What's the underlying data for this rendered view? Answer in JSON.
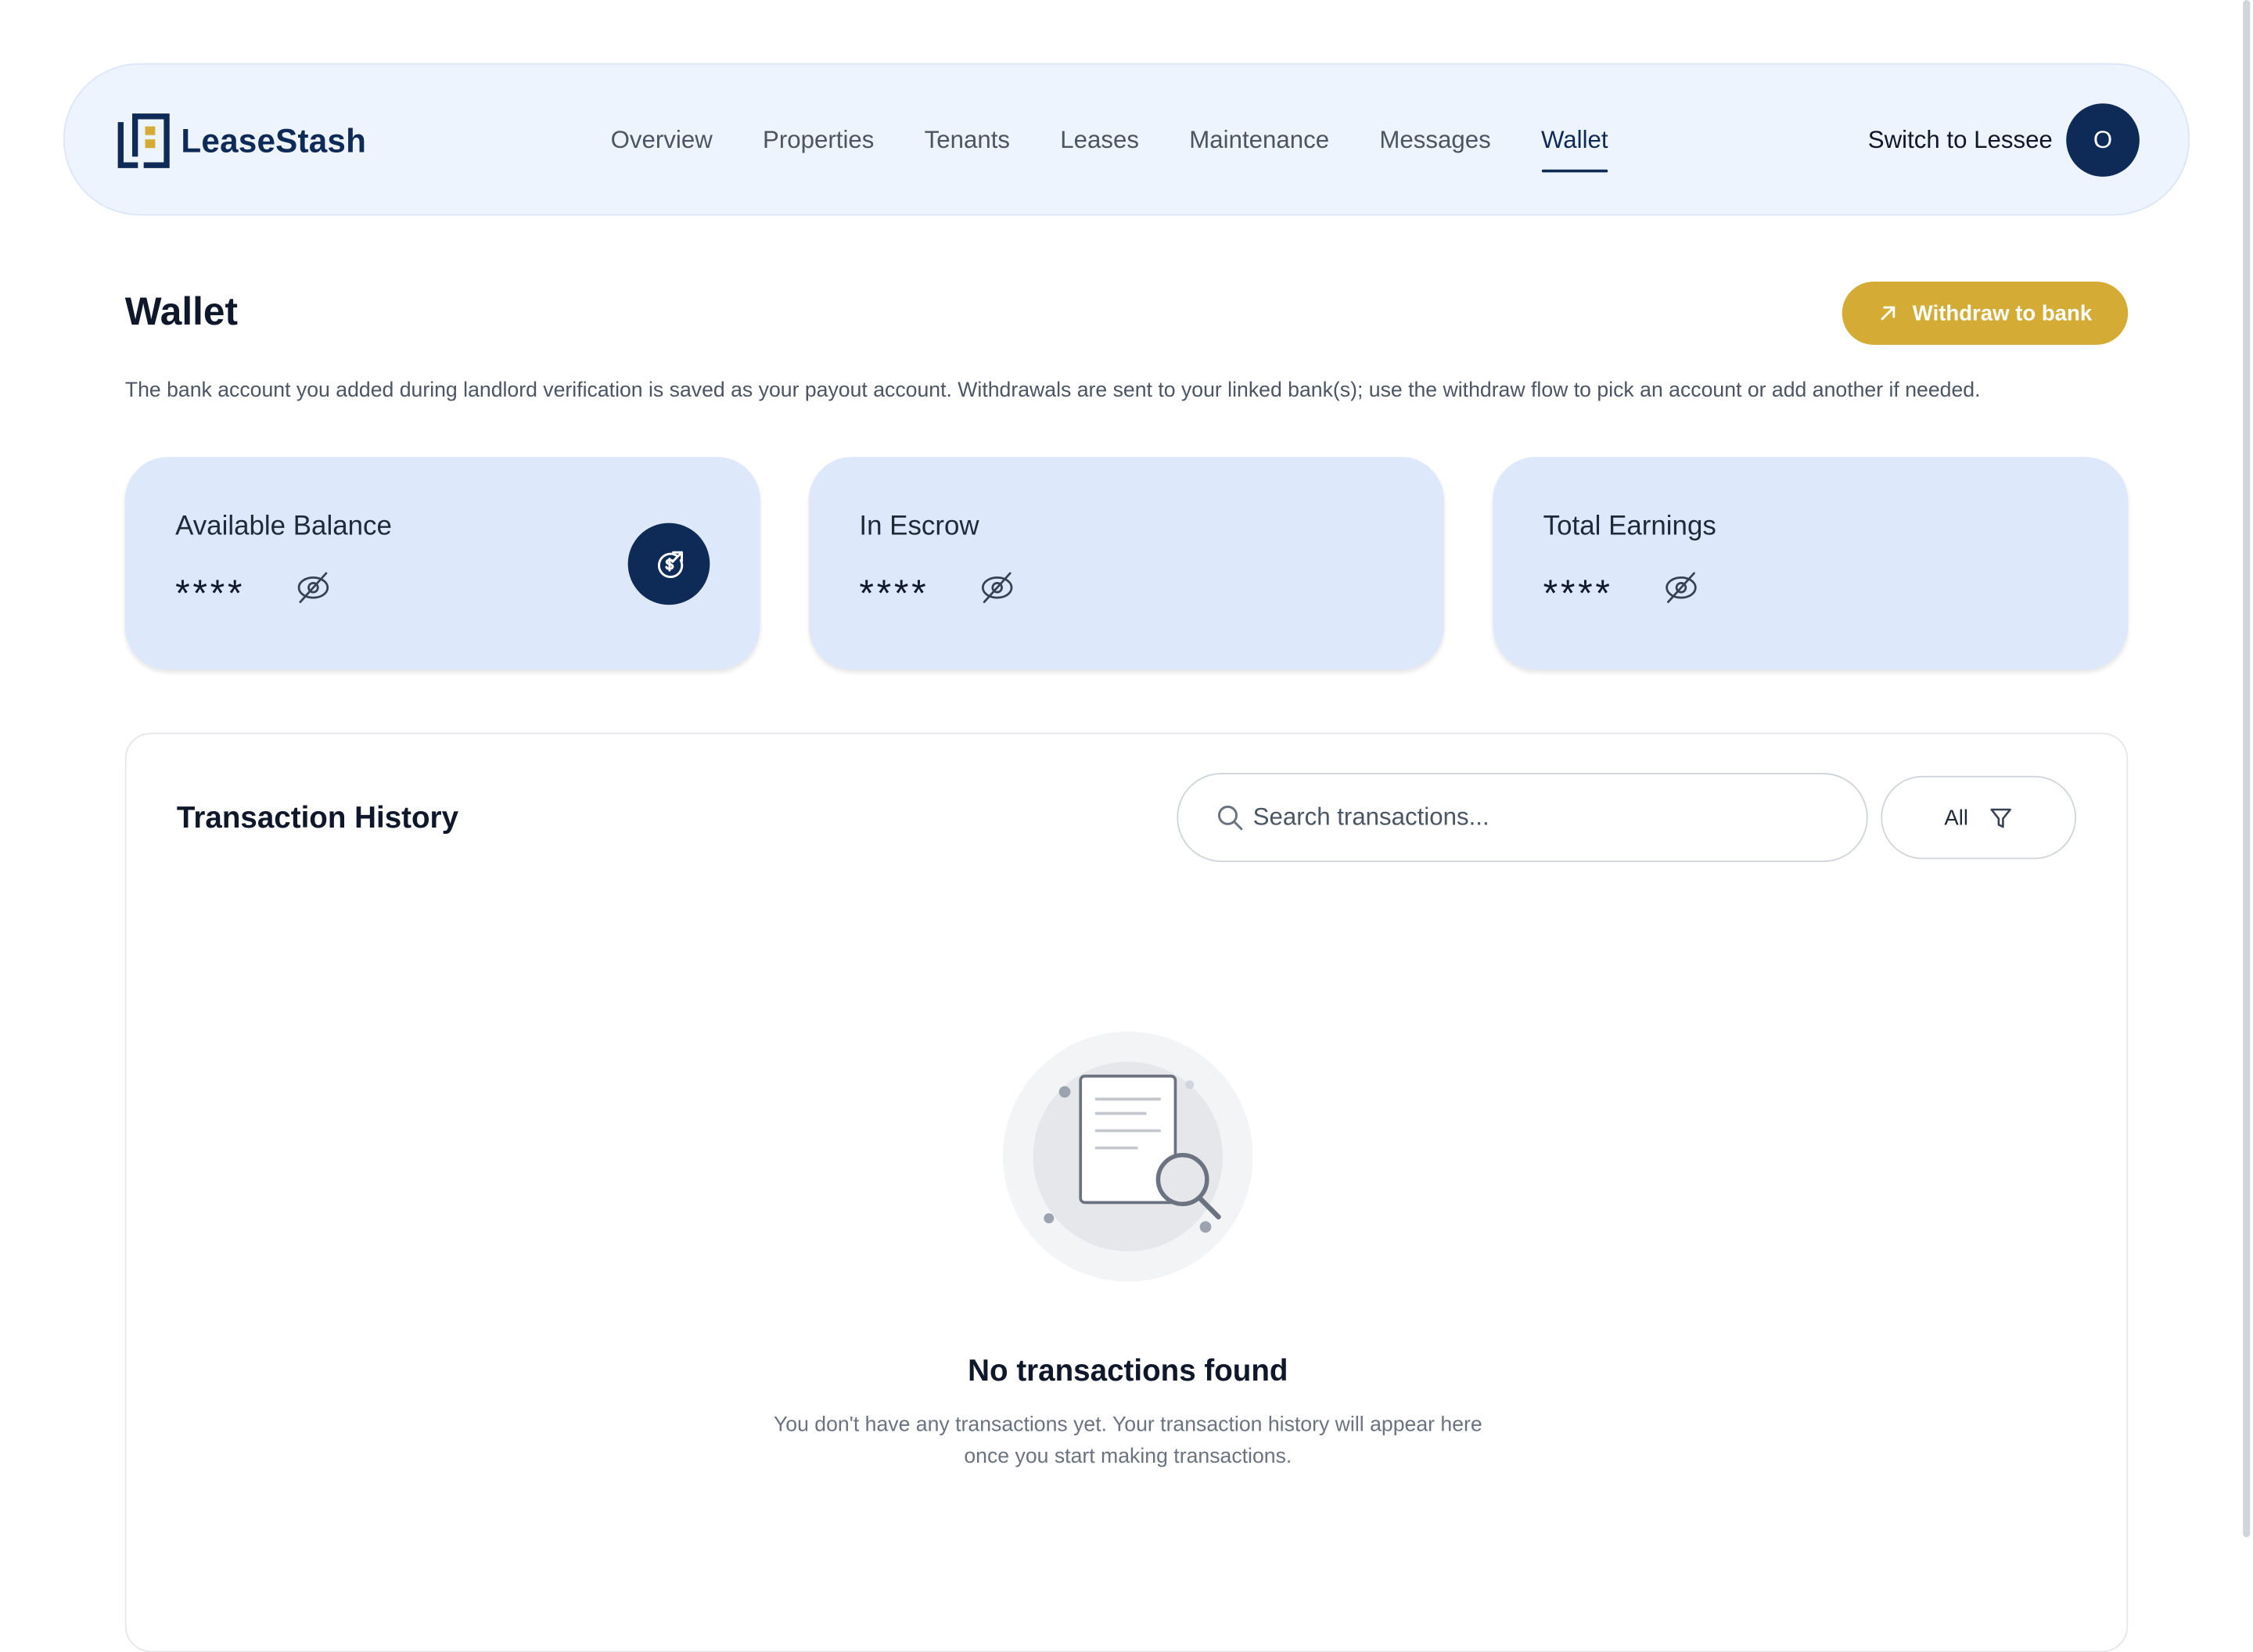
{
  "app": {
    "brand_name": "LeaseStash",
    "brand_colors": {
      "navy": "#0e2a57",
      "gold": "#d4ac35"
    }
  },
  "nav": {
    "items": [
      {
        "label": "Overview"
      },
      {
        "label": "Properties"
      },
      {
        "label": "Tenants"
      },
      {
        "label": "Leases"
      },
      {
        "label": "Maintenance"
      },
      {
        "label": "Messages"
      },
      {
        "label": "Wallet",
        "active": true
      }
    ]
  },
  "header": {
    "switch_label": "Switch to Lessee",
    "avatar_initial": "O"
  },
  "page": {
    "title": "Wallet",
    "withdraw_label": "Withdraw to bank",
    "withdraw_icon": "arrow-up-right-icon",
    "description": "The bank account you added during landlord verification is saved as your payout account. Withdrawals are sent to your linked bank(s); use the withdraw flow to pick an account or add another if needed."
  },
  "cards": [
    {
      "label": "Available Balance",
      "value": "****",
      "icon": "eye-off-icon",
      "badge_icon": "dollar-arrow-icon"
    },
    {
      "label": "In Escrow",
      "value": "****",
      "icon": "eye-off-icon"
    },
    {
      "label": "Total Earnings",
      "value": "****",
      "icon": "eye-off-icon"
    }
  ],
  "transactions": {
    "title": "Transaction History",
    "search_placeholder": "Search transactions...",
    "search_value": "",
    "filter_label": "All",
    "filter_icon": "filter-icon",
    "empty_illustration_icon": "document-search-icon",
    "empty_title": "No transactions found",
    "empty_text": "You don't have any transactions yet. Your transaction history will appear here once you start making transactions."
  }
}
